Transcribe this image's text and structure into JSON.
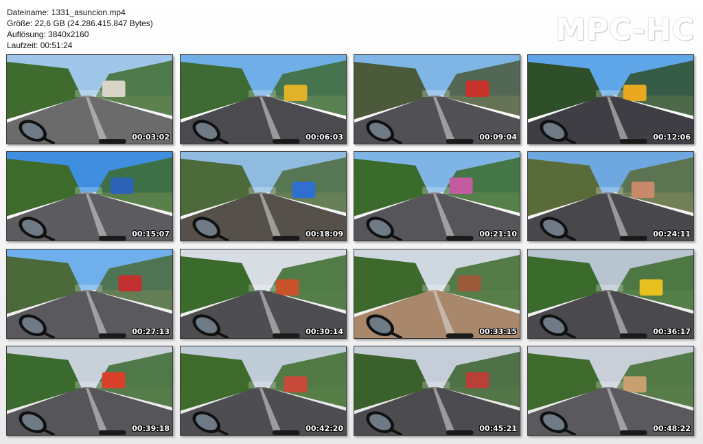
{
  "file_info": {
    "filename": "Dateiname: 1331_asuncion.mp4",
    "size": "Größe: 22,6 GB (24.286.415.847 Bytes)",
    "resolution": "Auflösung: 3840x2160",
    "duration": "Laufzeit: 00:51:24"
  },
  "brand": "MPC-HC",
  "thumbnails": [
    {
      "time": "00:03:02",
      "sky": "#9fc6e8",
      "road": "#6b6b6b",
      "side": "#3f6b2f",
      "accent": "#d8d4c8"
    },
    {
      "time": "00:06:03",
      "sky": "#6faee6",
      "road": "#4a4a4f",
      "side": "#3e6a33",
      "accent": "#e0b22a"
    },
    {
      "time": "00:09:04",
      "sky": "#7fb6e6",
      "road": "#505055",
      "side": "#4a5a3a",
      "accent": "#c8332b"
    },
    {
      "time": "00:12:06",
      "sky": "#5ea6e8",
      "road": "#3e3e44",
      "side": "#2f4f2a",
      "accent": "#e8a820"
    },
    {
      "time": "00:15:07",
      "sky": "#3f8ee0",
      "road": "#5c5c60",
      "side": "#3d6b2c",
      "accent": "#2f63b8"
    },
    {
      "time": "00:18:09",
      "sky": "#8fbbe0",
      "road": "#55504a",
      "side": "#4d6a3a",
      "accent": "#2e6fd0"
    },
    {
      "time": "00:21:10",
      "sky": "#7fb4e6",
      "road": "#56565a",
      "side": "#3a6b2c",
      "accent": "#c45aa0"
    },
    {
      "time": "00:24:11",
      "sky": "#6fa8e0",
      "road": "#48484c",
      "side": "#5a6b3a",
      "accent": "#c88a6a"
    },
    {
      "time": "00:27:13",
      "sky": "#6fb0ec",
      "road": "#5a5a5e",
      "side": "#4a6a3a",
      "accent": "#c23030"
    },
    {
      "time": "00:30:14",
      "sky": "#d8dde4",
      "road": "#4e4e52",
      "side": "#3a6b2c",
      "accent": "#c8522a"
    },
    {
      "time": "00:33:15",
      "sky": "#cfd8e0",
      "road": "#a8876a",
      "side": "#3d6a2c",
      "accent": "#9a5a3a"
    },
    {
      "time": "00:36:17",
      "sky": "#b8c4d0",
      "road": "#4a4a4e",
      "side": "#3a6b2c",
      "accent": "#e8c020"
    },
    {
      "time": "00:39:18",
      "sky": "#c8d0da",
      "road": "#55555a",
      "side": "#3a6a2e",
      "accent": "#d8402a"
    },
    {
      "time": "00:42:20",
      "sky": "#c0ccd8",
      "road": "#4e4e52",
      "side": "#3e6b2c",
      "accent": "#c84a3a"
    },
    {
      "time": "00:45:21",
      "sky": "#c4cdd8",
      "road": "#4c4c50",
      "side": "#3a602c",
      "accent": "#b84038"
    },
    {
      "time": "00:48:22",
      "sky": "#c8cfd8",
      "road": "#5a5a5e",
      "side": "#3e6a2e",
      "accent": "#c8a070"
    }
  ]
}
